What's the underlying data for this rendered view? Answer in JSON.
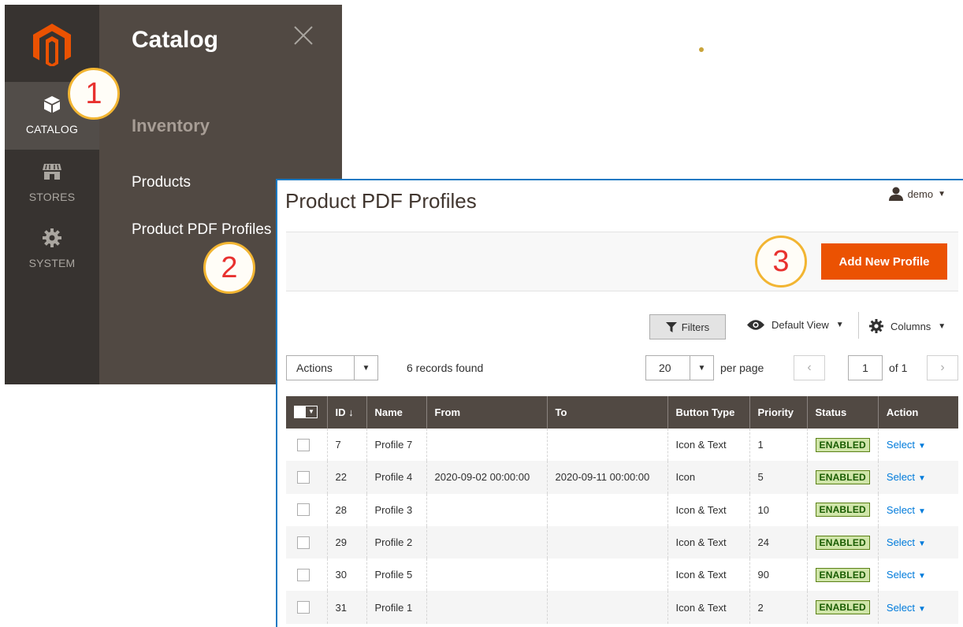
{
  "menu": {
    "sidebar": [
      {
        "label": "CATALOG",
        "icon": "box-icon",
        "active": true
      },
      {
        "label": "STORES",
        "icon": "storefront-icon",
        "active": false
      },
      {
        "label": "SYSTEM",
        "icon": "gear-icon",
        "active": false
      }
    ],
    "title": "Catalog",
    "group": "Inventory",
    "items": [
      "Products",
      "Product PDF Profiles"
    ]
  },
  "callouts": [
    "1",
    "2",
    "3"
  ],
  "page": {
    "title": "Product PDF Profiles",
    "user": "demo",
    "add_button": "Add New Profile"
  },
  "toolbar": {
    "filters": "Filters",
    "view": "Default View",
    "columns": "Columns",
    "actions": "Actions",
    "records": "6 records found",
    "per_page_value": "20",
    "per_page_label": "per page",
    "current_page": "1",
    "page_total": "of 1"
  },
  "table": {
    "headers": [
      "",
      "ID",
      "Name",
      "From",
      "To",
      "Button Type",
      "Priority",
      "Status",
      "Action"
    ],
    "sort_indicator": "↓",
    "rows": [
      {
        "id": "7",
        "name": "Profile 7",
        "from": "",
        "to": "",
        "button_type": "Icon & Text",
        "priority": "1",
        "status": "ENABLED",
        "action": "Select"
      },
      {
        "id": "22",
        "name": "Profile 4",
        "from": "2020-09-02 00:00:00",
        "to": "2020-09-11 00:00:00",
        "button_type": "Icon",
        "priority": "5",
        "status": "ENABLED",
        "action": "Select"
      },
      {
        "id": "28",
        "name": "Profile 3",
        "from": "",
        "to": "",
        "button_type": "Icon & Text",
        "priority": "10",
        "status": "ENABLED",
        "action": "Select"
      },
      {
        "id": "29",
        "name": "Profile 2",
        "from": "",
        "to": "",
        "button_type": "Icon & Text",
        "priority": "24",
        "status": "ENABLED",
        "action": "Select"
      },
      {
        "id": "30",
        "name": "Profile 5",
        "from": "",
        "to": "",
        "button_type": "Icon & Text",
        "priority": "90",
        "status": "ENABLED",
        "action": "Select"
      },
      {
        "id": "31",
        "name": "Profile 1",
        "from": "",
        "to": "",
        "button_type": "Icon & Text",
        "priority": "2",
        "status": "ENABLED",
        "action": "Select"
      }
    ]
  },
  "colors": {
    "accent": "#eb5202",
    "sidebar": "#373330",
    "menu_panel": "#514943",
    "link": "#007bdb",
    "status_bg": "#d0e5a9",
    "callout_ring": "#f2b532",
    "callout_number": "#e8312f"
  }
}
